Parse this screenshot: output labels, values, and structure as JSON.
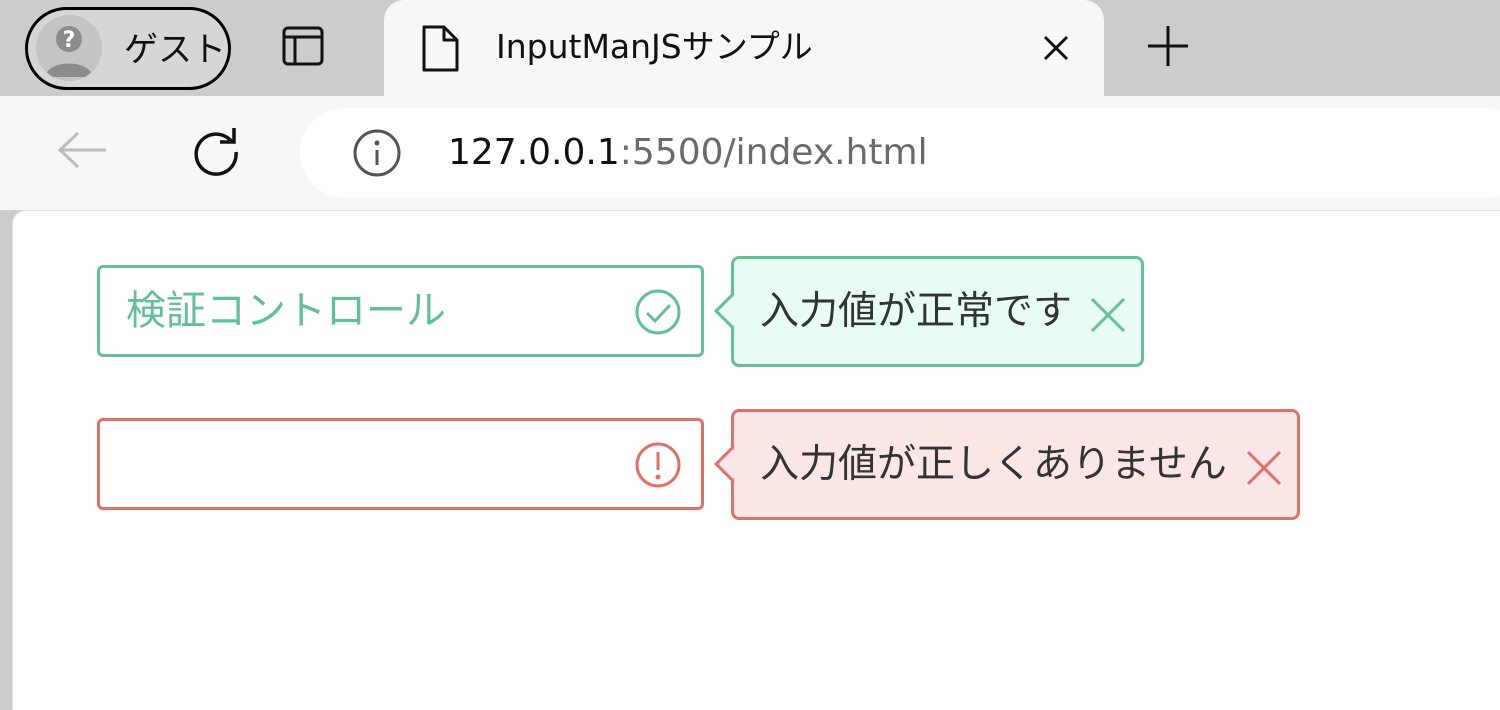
{
  "profile": {
    "name": "ゲスト",
    "avatar_icon": "guest-avatar-icon"
  },
  "tabs": [
    {
      "title": "InputManJSサンプル",
      "icon": "page-icon",
      "active": true
    }
  ],
  "toolbar": {
    "url_host": "127.0.0.1",
    "url_rest": ":5500/index.html"
  },
  "form": {
    "valid_field": {
      "value": "検証コントロール",
      "icon": "check-circle-icon",
      "message": "入力値が正常です"
    },
    "invalid_field": {
      "value": "",
      "icon": "exclamation-circle-icon",
      "message": "入力値が正しくありません"
    }
  },
  "colors": {
    "valid": "#62bf98",
    "valid_bg": "#e8fcf4",
    "invalid": "#e07068",
    "invalid_bg": "#fbe6e6"
  }
}
